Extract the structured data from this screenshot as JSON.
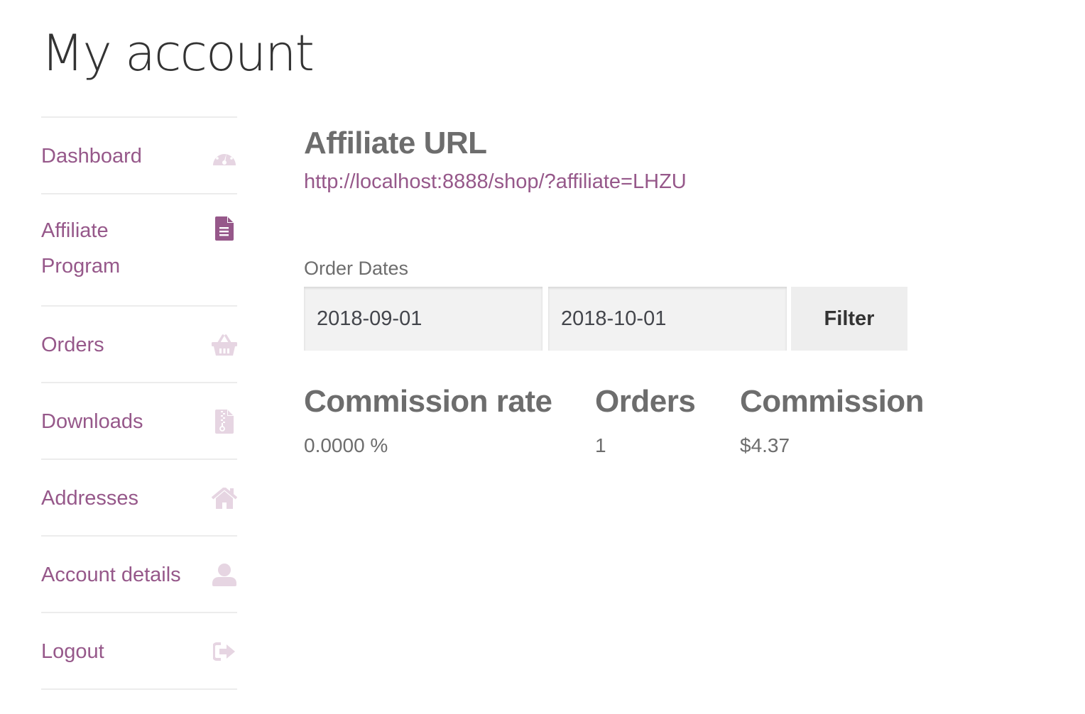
{
  "page": {
    "title": "My account"
  },
  "colors": {
    "accent": "#96588a",
    "icon_muted": "#e6d5e2",
    "heading": "#6d6d6d",
    "divider": "#ececec"
  },
  "sidebar": {
    "items": [
      {
        "label": "Dashboard",
        "icon": "dashboard-gauge-icon",
        "active": false
      },
      {
        "label": "Affiliate Program",
        "icon": "file-text-icon",
        "active": true
      },
      {
        "label": "Orders",
        "icon": "basket-icon",
        "active": false
      },
      {
        "label": "Downloads",
        "icon": "file-zip-icon",
        "active": false
      },
      {
        "label": "Addresses",
        "icon": "home-icon",
        "active": false
      },
      {
        "label": "Account details",
        "icon": "user-icon",
        "active": false
      },
      {
        "label": "Logout",
        "icon": "sign-out-icon",
        "active": false
      }
    ]
  },
  "affiliate": {
    "heading": "Affiliate URL",
    "url": "http://localhost:8888/shop/?affiliate=LHZU"
  },
  "filter": {
    "label": "Order Dates",
    "date_from": "2018-09-01",
    "date_to": "2018-10-01",
    "button_label": "Filter"
  },
  "stats": {
    "commission_rate_label": "Commission rate",
    "commission_rate_value": "0.0000 %",
    "orders_label": "Orders",
    "orders_value": "1",
    "commission_label": "Commission",
    "commission_value": "$4.37"
  }
}
